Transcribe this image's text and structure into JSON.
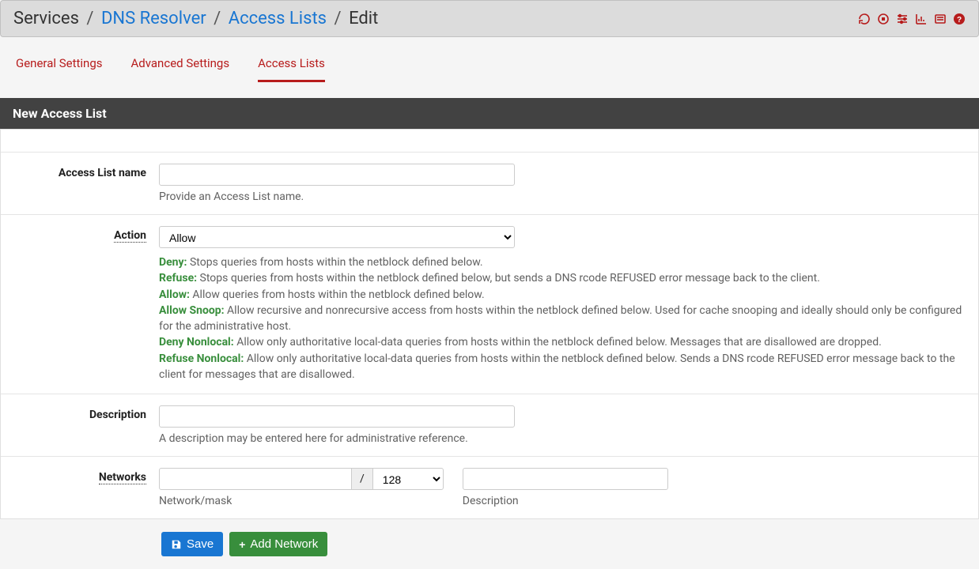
{
  "breadcrumb": {
    "root": "Services",
    "level1": "DNS Resolver",
    "level2": "Access Lists",
    "current": "Edit"
  },
  "tabs": {
    "general": "General Settings",
    "advanced": "Advanced Settings",
    "access": "Access Lists"
  },
  "panel": {
    "title": "New Access List"
  },
  "fields": {
    "name_label": "Access List name",
    "name_value": "",
    "name_help": "Provide an Access List name.",
    "action_label": "Action",
    "action_value": "Allow",
    "action_options": [
      "Deny",
      "Refuse",
      "Allow",
      "Allow Snoop",
      "Deny Nonlocal",
      "Refuse Nonlocal"
    ],
    "deny_term": "Deny:",
    "deny_text": " Stops queries from hosts within the netblock defined below.",
    "refuse_term": "Refuse:",
    "refuse_text": " Stops queries from hosts within the netblock defined below, but sends a DNS rcode REFUSED error message back to the client.",
    "allow_term": "Allow:",
    "allow_text": " Allow queries from hosts within the netblock defined below.",
    "snoop_term": "Allow Snoop:",
    "snoop_text": " Allow recursive and nonrecursive access from hosts within the netblock defined below. Used for cache snooping and ideally should only be configured for the administrative host.",
    "denynl_term": "Deny Nonlocal:",
    "denynl_text": " Allow only authoritative local-data queries from hosts within the netblock defined below. Messages that are disallowed are dropped.",
    "refusenl_term": "Refuse Nonlocal:",
    "refusenl_text": " Allow only authoritative local-data queries from hosts within the netblock defined below. Sends a DNS rcode REFUSED error message back to the client for messages that are disallowed.",
    "desc_label": "Description",
    "desc_value": "",
    "desc_help": "A description may be entered here for administrative reference.",
    "networks_label": "Networks",
    "network_value": "",
    "mask_sep": "/",
    "mask_value": "128",
    "network_sublabel": "Network/mask",
    "netdesc_value": "",
    "netdesc_sublabel": "Description"
  },
  "buttons": {
    "save": "Save",
    "add_network": "Add Network"
  }
}
